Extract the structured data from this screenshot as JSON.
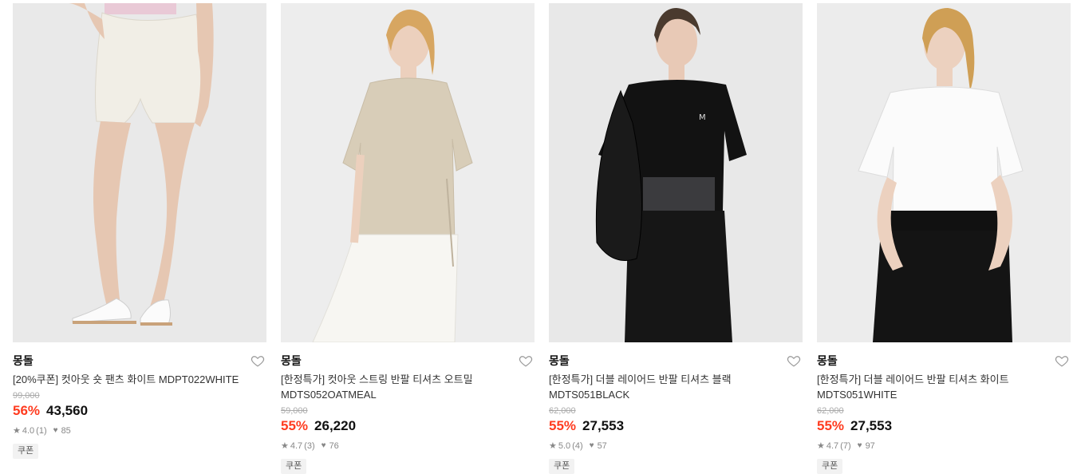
{
  "products": [
    {
      "brand": "몽돌",
      "name": "[20%쿠폰] 컷아웃 숏 팬츠 화이트 MDPT022WHITE",
      "original_price": "99,000",
      "discount": "56%",
      "price": "43,560",
      "rating": "4.0",
      "reviews": "(1)",
      "likes": "85",
      "badge": "쿠폰",
      "image": "model-white-shorts",
      "colors": {
        "bg": "#e9e9e9",
        "garment": "#f1eee6",
        "skin": "#e6c7b2",
        "pants": "#f1eee6"
      }
    },
    {
      "brand": "몽돌",
      "name": "[한정특가] 컷아웃 스트링 반팔 티셔츠 오트밀 MDTS052OATMEAL",
      "original_price": "59,000",
      "discount": "55%",
      "price": "26,220",
      "rating": "4.7",
      "reviews": "(3)",
      "likes": "76",
      "badge": "쿠폰",
      "image": "model-oatmeal-tshirt",
      "colors": {
        "bg": "#ededed",
        "garment": "#d8cdb8",
        "skin": "#ecd0bd",
        "pants": "#f7f6f2"
      }
    },
    {
      "brand": "몽돌",
      "name": "[한정특가] 더블 레이어드 반팔 티셔츠 블랙 MDTS051BLACK",
      "original_price": "62,000",
      "discount": "55%",
      "price": "27,553",
      "rating": "5.0",
      "reviews": "(4)",
      "likes": "57",
      "badge": "쿠폰",
      "image": "model-black-tshirt",
      "colors": {
        "bg": "#e8e8e8",
        "garment": "#121212",
        "skin": "#e8c9b6",
        "pants": "#161616"
      }
    },
    {
      "brand": "몽돌",
      "name": "[한정특가] 더블 레이어드 반팔 티셔츠 화이트 MDTS051WHITE",
      "original_price": "62,000",
      "discount": "55%",
      "price": "27,553",
      "rating": "4.7",
      "reviews": "(7)",
      "likes": "97",
      "badge": "쿠폰",
      "image": "model-white-tshirt",
      "colors": {
        "bg": "#ececec",
        "garment": "#fbfbfb",
        "skin": "#ecd1bf",
        "pants": "#141414"
      }
    }
  ],
  "accent": "#ff3b1f"
}
